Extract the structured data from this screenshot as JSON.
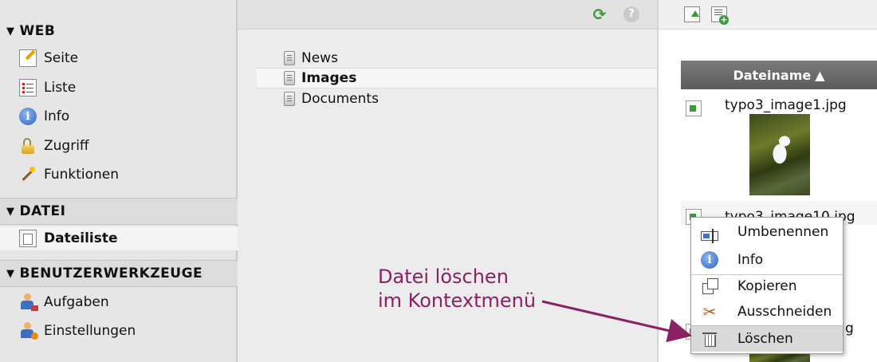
{
  "module_menu": {
    "groups": [
      {
        "label": "WEB",
        "items": [
          {
            "label": "Seite",
            "icon": "page-edit-icon"
          },
          {
            "label": "Liste",
            "icon": "list-icon"
          },
          {
            "label": "Info",
            "icon": "info-icon"
          },
          {
            "label": "Zugriff",
            "icon": "lock-icon"
          },
          {
            "label": "Funktionen",
            "icon": "wand-icon"
          }
        ]
      },
      {
        "label": "DATEI",
        "items": [
          {
            "label": "Dateiliste",
            "icon": "filelist-icon",
            "active": true
          }
        ]
      },
      {
        "label": "BENUTZERWERKZEUGE",
        "items": [
          {
            "label": "Aufgaben",
            "icon": "user-tasks-icon"
          },
          {
            "label": "Einstellungen",
            "icon": "user-settings-icon"
          }
        ]
      }
    ]
  },
  "folder_tree": {
    "toolbar_icons": [
      "refresh-icon",
      "help-icon"
    ],
    "nodes": [
      {
        "label": "News",
        "selected": false
      },
      {
        "label": "Images",
        "selected": true
      },
      {
        "label": "Documents",
        "selected": false
      }
    ]
  },
  "file_list": {
    "toolbar_icons": [
      "upload-icon",
      "new-file-icon"
    ],
    "column_header": "Dateiname",
    "sort_indicator": "▲",
    "files": [
      {
        "name": "typo3_image1.jpg"
      },
      {
        "name": "typo3_image10.jpg"
      }
    ]
  },
  "context_menu": {
    "items": [
      {
        "label": "Umbenennen",
        "icon": "rename-icon"
      },
      {
        "label": "Info",
        "icon": "info-icon"
      },
      {
        "label": "Kopieren",
        "icon": "copy-icon"
      },
      {
        "label": "Ausschneiden",
        "icon": "cut-icon"
      },
      {
        "label": "Löschen",
        "icon": "trash-icon",
        "highlighted": true
      }
    ]
  },
  "annotation": {
    "line1": "Datei löschen",
    "line2": "im Kontextmenü",
    "color": "#8b2063"
  },
  "colors": {
    "sidebar_bg": "#e6e6e6",
    "header_bg": "#5c5c5c",
    "accent_green": "#3b9a32"
  }
}
